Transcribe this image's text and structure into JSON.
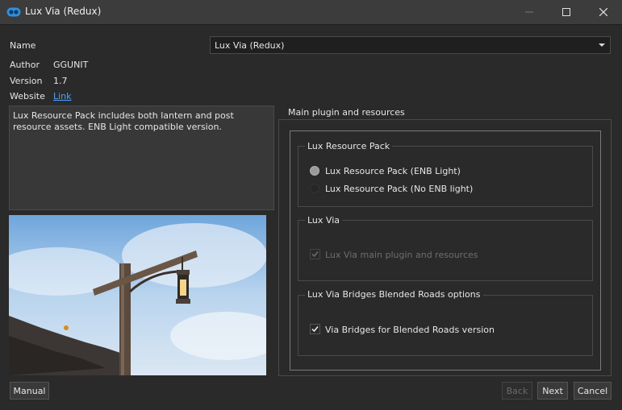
{
  "window": {
    "title": "Lux Via (Redux)"
  },
  "info": {
    "name_label": "Name",
    "author_label": "Author",
    "author": "GGUNIT",
    "version_label": "Version",
    "version": "1.7",
    "website_label": "Website",
    "website_link": "Link"
  },
  "combo": {
    "selected": "Lux Via (Redux)"
  },
  "description": "Lux Resource Pack includes both lantern and post resource assets. ENB Light compatible version.",
  "main_group": {
    "title": "Main plugin and resources",
    "resource_pack": {
      "title": "Lux Resource Pack",
      "options": [
        {
          "label": "Lux Resource Pack (ENB Light)",
          "checked": true
        },
        {
          "label": "Lux Resource Pack (No ENB light)",
          "checked": false
        }
      ]
    },
    "lux_via": {
      "title": "Lux Via",
      "option": {
        "label": "Lux Via main plugin and resources",
        "checked": true,
        "disabled": true
      }
    },
    "bridges": {
      "title": "Lux Via Bridges Blended Roads options",
      "option": {
        "label": "Via Bridges for Blended Roads version",
        "checked": true
      }
    }
  },
  "buttons": {
    "manual": "Manual",
    "back": "Back",
    "next": "Next",
    "cancel": "Cancel"
  },
  "colors": {
    "background": "#2a2a2a",
    "titlebar": "#3c3c3c",
    "link": "#4ea1ff"
  }
}
